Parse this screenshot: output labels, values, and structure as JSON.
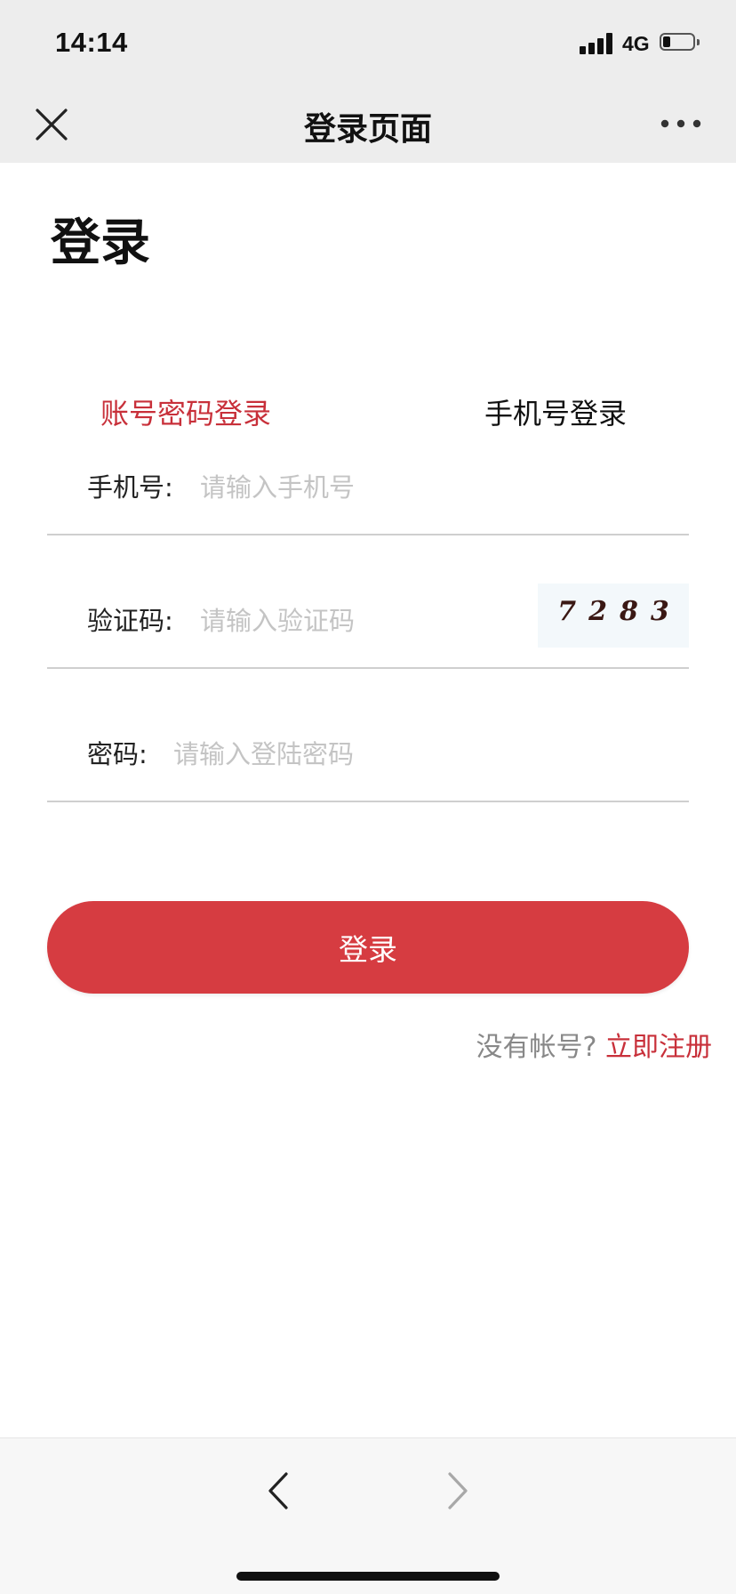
{
  "status_bar": {
    "time": "14:14",
    "network": "4G"
  },
  "nav": {
    "title": "登录页面",
    "close_icon": "close-icon",
    "more_icon": "more-icon"
  },
  "heading": "登录",
  "tabs": [
    {
      "label": "账号密码登录",
      "active": true
    },
    {
      "label": "手机号登录",
      "active": false
    }
  ],
  "form": {
    "phone": {
      "label": "手机号:",
      "placeholder": "请输入手机号",
      "value": ""
    },
    "code": {
      "label": "验证码:",
      "placeholder": "请输入验证码",
      "value": "",
      "captcha": "7283"
    },
    "password": {
      "label": "密码:",
      "placeholder": "请输入登陆密码",
      "value": ""
    }
  },
  "login_button": "登录",
  "register": {
    "hint": "没有帐号?",
    "link": "立即注册"
  },
  "toolbar": {
    "back_icon": "chevron-left-icon",
    "forward_icon": "chevron-right-icon"
  },
  "colors": {
    "accent": "#d63c41",
    "accent_text": "#c8303a",
    "top_bg": "#ededed",
    "placeholder": "#c4c4c4"
  }
}
